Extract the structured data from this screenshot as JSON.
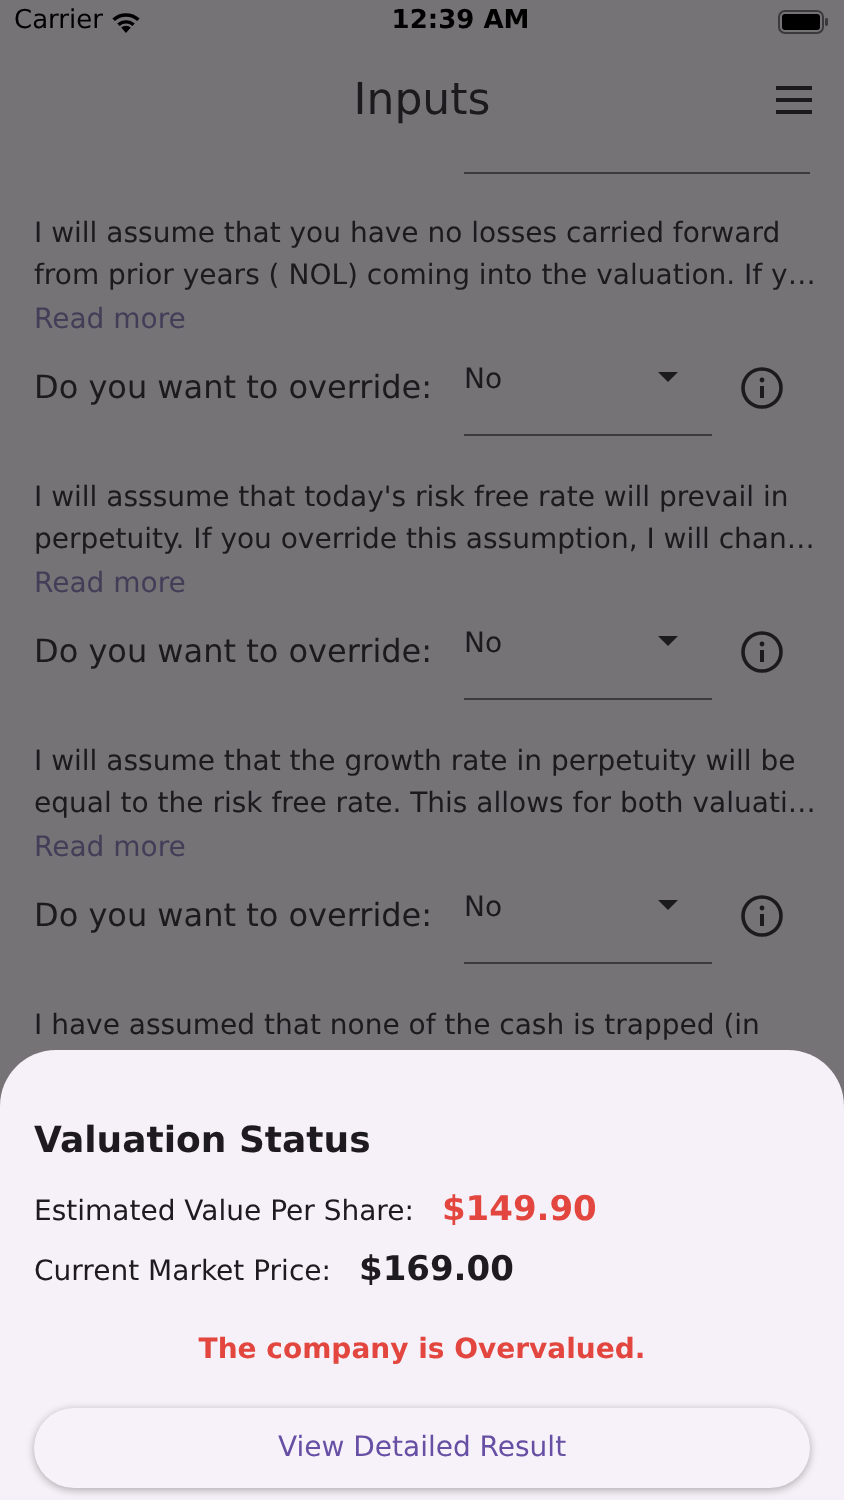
{
  "status_bar": {
    "carrier": "Carrier",
    "time": "12:39 AM"
  },
  "app_bar": {
    "title": "Inputs"
  },
  "assumptions": [
    {
      "description_lines": [
        "I will assume that you have no losses carried forward",
        "from prior years ( NOL) coming into the valuation. If y…"
      ],
      "link": "Read more",
      "override": {
        "label": "Do you want to override:",
        "value": "No"
      }
    },
    {
      "description_lines": [
        "I will asssume that today's risk free rate will prevail in",
        "perpetuity. If you override this assumption, I will chan…"
      ],
      "link": "Read more",
      "override": {
        "label": "Do you want to override:",
        "value": "No"
      }
    },
    {
      "description_lines": [
        "I will assume that the growth rate in perpetuity will be",
        "equal to the risk free rate. This allows for both valuati…"
      ],
      "link": "Read more",
      "override": {
        "label": "Do you want to override:",
        "value": "No"
      }
    },
    {
      "description_lines": [
        "I have assumed that none of the cash is trapped (in"
      ]
    }
  ],
  "valuation_status": {
    "title": "Valuation Status",
    "rows": [
      {
        "kind": "estimate",
        "label": "Estimated Value Per Share:",
        "value": "$149.90"
      },
      {
        "kind": "price",
        "label": "Current Market Price:",
        "value": "$169.00"
      }
    ],
    "verdict": "The company is Overvalued.",
    "button": "View Detailed Result"
  }
}
